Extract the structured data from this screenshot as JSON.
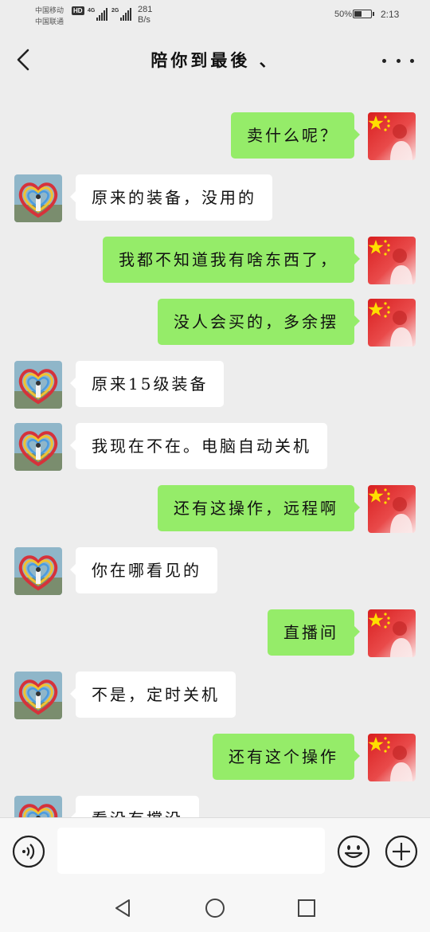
{
  "status_bar": {
    "carrier_1": "中国移动",
    "carrier_2": "中国联通",
    "hd_badge": "HD",
    "network_1": "4G",
    "network_2": "2G",
    "net_speed_value": "281",
    "net_speed_unit": "B/s",
    "battery_percent": "50%",
    "battery_level": 0.5,
    "time": "2:13"
  },
  "header": {
    "title": "陪你到最後 、",
    "back_icon": "chevron-left-icon",
    "more_icon": "more-dots-icon"
  },
  "messages": [
    {
      "side": "out",
      "text": "卖什么呢？"
    },
    {
      "side": "in",
      "text": "原来的装备，没用的"
    },
    {
      "side": "out",
      "text": "我都不知道我有啥东西了，"
    },
    {
      "side": "out",
      "text": "没人会买的，多余摆"
    },
    {
      "side": "in",
      "text": "原来15级装备"
    },
    {
      "side": "in",
      "text": "我现在不在。电脑自动关机"
    },
    {
      "side": "out",
      "text": "还有这操作，远程啊"
    },
    {
      "side": "in",
      "text": "你在哪看见的"
    },
    {
      "side": "out",
      "text": "直播间"
    },
    {
      "side": "in",
      "text": "不是，定时关机"
    },
    {
      "side": "out",
      "text": "还有这个操作"
    },
    {
      "side": "in",
      "text": "看没有撑没"
    }
  ],
  "input_bar": {
    "voice_icon": "voice-input-icon",
    "text_value": "",
    "emoji_icon": "emoji-icon",
    "plus_icon": "plus-icon"
  },
  "system_nav": {
    "back_icon": "triangle-back-icon",
    "home_icon": "circle-home-icon",
    "recents_icon": "square-recents-icon"
  },
  "colors": {
    "background": "#ededed",
    "outgoing_bubble": "#95ec69",
    "incoming_bubble": "#ffffff"
  }
}
